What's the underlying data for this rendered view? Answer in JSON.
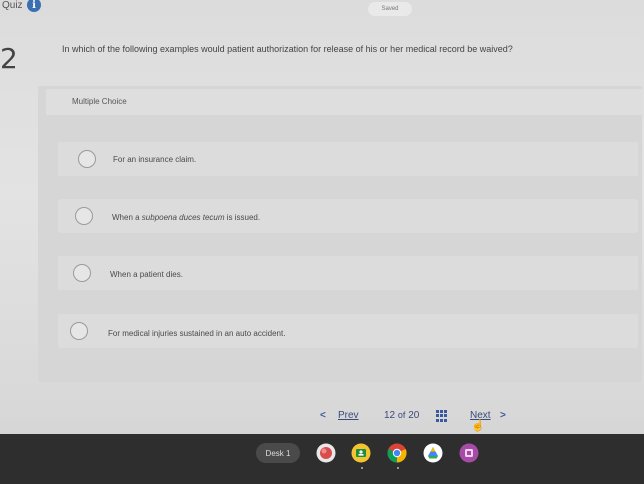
{
  "header": {
    "quiz_label": "Quiz",
    "info_glyph": "i",
    "saved_status": "Saved"
  },
  "question": {
    "number": "2",
    "text": "In which of the following examples would patient authorization for release of his or her medical record be waived?",
    "type_label": "Multiple Choice"
  },
  "options": [
    {
      "label": "For an insurance claim."
    },
    {
      "prefix": "When a ",
      "italic": "subpoena duces tecum",
      "suffix": " is issued."
    },
    {
      "label": "When a patient dies."
    },
    {
      "label": "For medical injuries sustained in an auto accident."
    }
  ],
  "navigation": {
    "prev_glyph": "<",
    "prev_label": "Prev",
    "page_current": "12",
    "page_of": "of",
    "page_total": "20",
    "next_label": "Next",
    "next_glyph": ">"
  },
  "shelf": {
    "desk_label": "Desk 1",
    "apps": [
      {
        "icon": "red-app-icon",
        "color": "#d94c4c"
      },
      {
        "icon": "classroom-icon",
        "color": "#f4c430"
      },
      {
        "icon": "chrome-icon",
        "color": "#4285f4"
      },
      {
        "icon": "drive-icon",
        "color": "#34a853"
      },
      {
        "icon": "purple-app-icon",
        "color": "#a64ca6"
      }
    ]
  }
}
